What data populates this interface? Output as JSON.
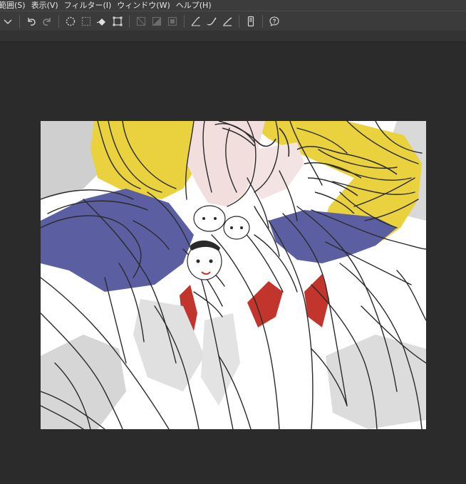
{
  "menu": {
    "items": [
      "範囲(S)",
      "表示(V)",
      "フィルター(I)",
      "ウィンドウ(W)",
      "ヘルプ(H)"
    ]
  },
  "toolbar": {
    "icons": [
      "dropdown-chevron-icon",
      "undo-icon",
      "redo-icon",
      "clear-selection-icon",
      "select-all-icon",
      "fill-icon",
      "transform-icon",
      "disabled-tool-1-icon",
      "disabled-tool-2-icon",
      "disabled-tool-3-icon",
      "pen-correction-1-icon",
      "pen-correction-2-icon",
      "pen-correction-3-icon",
      "smartphone-icon",
      "help-icon"
    ]
  },
  "colors": {
    "ui_bg": "#2b2b2b",
    "toolbar_bg": "#3b3b3b",
    "hair_yellow": "#e9d23e",
    "uniform_blue": "#5b5fa2",
    "ribbon_red": "#c2352d"
  },
  "canvas": {
    "artwork_name": "sketch-artwork"
  }
}
